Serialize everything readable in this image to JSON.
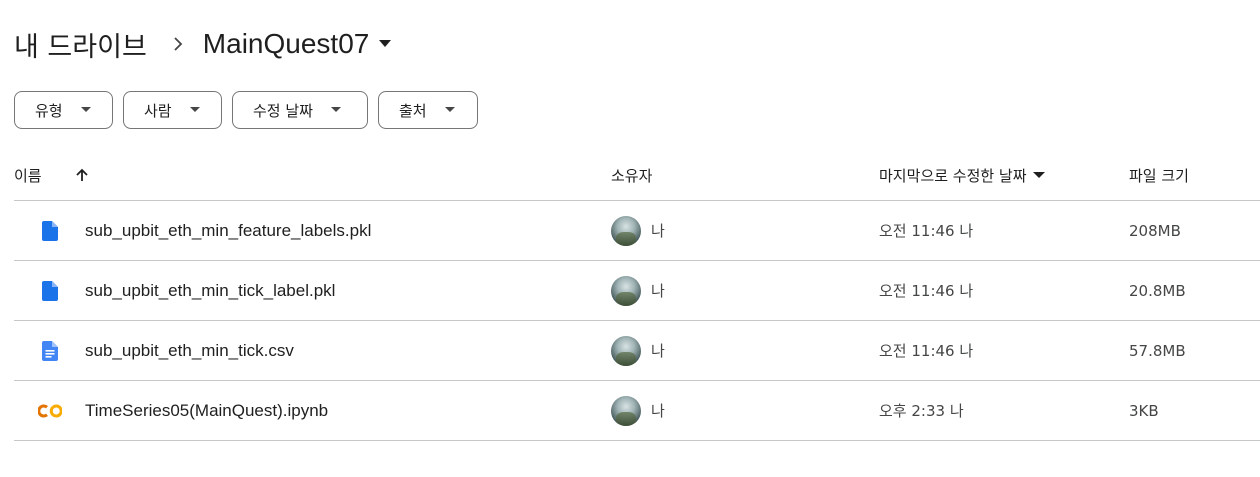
{
  "breadcrumb": {
    "root": "내 드라이브",
    "current": "MainQuest07"
  },
  "filters": [
    {
      "label": "유형"
    },
    {
      "label": "사람"
    },
    {
      "label": "수정 날짜"
    },
    {
      "label": "출처"
    }
  ],
  "table": {
    "headers": {
      "name": "이름",
      "owner": "소유자",
      "modified": "마지막으로 수정한 날짜",
      "size": "파일 크기"
    },
    "rows": [
      {
        "icon": "file-icon",
        "name": "sub_upbit_eth_min_feature_labels.pkl",
        "owner": "나",
        "modified": "오전 11:46 나",
        "size": "208MB"
      },
      {
        "icon": "file-icon",
        "name": "sub_upbit_eth_min_tick_label.pkl",
        "owner": "나",
        "modified": "오전 11:46 나",
        "size": "20.8MB"
      },
      {
        "icon": "document-icon",
        "name": "sub_upbit_eth_min_tick.csv",
        "owner": "나",
        "modified": "오전 11:46 나",
        "size": "57.8MB"
      },
      {
        "icon": "colab-icon",
        "name": "TimeSeries05(MainQuest).ipynb",
        "owner": "나",
        "modified": "오후 2:33 나",
        "size": "3KB"
      }
    ]
  },
  "colors": {
    "file_blue": "#1a73e8",
    "doc_blue": "#4285f4",
    "colab_orange": "#f9ab00",
    "colab_dark_orange": "#e37400",
    "divider": "#c7c7c7"
  }
}
